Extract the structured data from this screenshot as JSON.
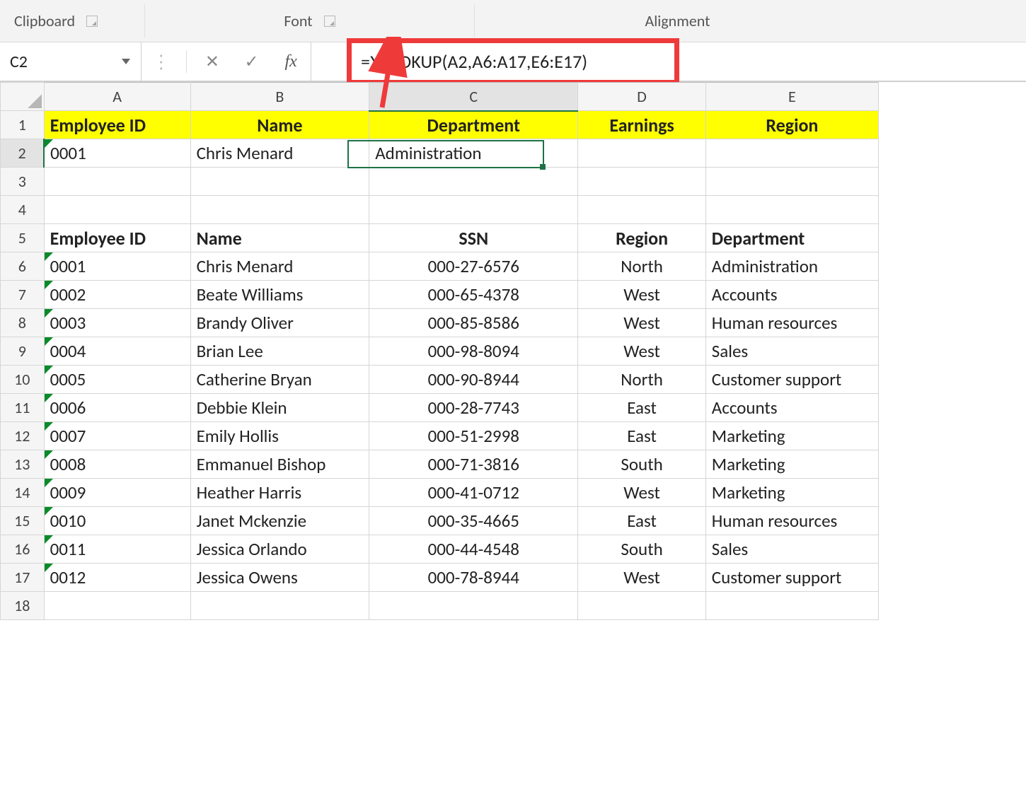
{
  "ribbon": {
    "clipboard": "Clipboard",
    "font": "Font",
    "alignment": "Alignment"
  },
  "formula_bar": {
    "name_box": "C2",
    "formula": "=XLOOKUP(A2,A6:A17,E6:E17)",
    "fx": "fx"
  },
  "columns": [
    "A",
    "B",
    "C",
    "D",
    "E"
  ],
  "rows": [
    "1",
    "2",
    "3",
    "4",
    "5",
    "6",
    "7",
    "8",
    "9",
    "10",
    "11",
    "12",
    "13",
    "14",
    "15",
    "16",
    "17",
    "18"
  ],
  "yellow_headers": {
    "A": "Employee ID",
    "B": "Name",
    "C": "Department",
    "D": "Earnings",
    "E": "Region"
  },
  "result_row": {
    "A": "0001",
    "B": "Chris Menard",
    "C": "Administration",
    "D": "",
    "E": ""
  },
  "table_headers": {
    "A": "Employee ID",
    "B": "Name",
    "C": "SSN",
    "D": "Region",
    "E": "Department"
  },
  "table_rows": [
    {
      "A": "0001",
      "B": "Chris Menard",
      "C": "000-27-6576",
      "D": "North",
      "E": "Administration"
    },
    {
      "A": "0002",
      "B": "Beate Williams",
      "C": "000-65-4378",
      "D": "West",
      "E": "Accounts"
    },
    {
      "A": "0003",
      "B": "Brandy Oliver",
      "C": "000-85-8586",
      "D": "West",
      "E": "Human resources"
    },
    {
      "A": "0004",
      "B": "Brian Lee",
      "C": "000-98-8094",
      "D": "West",
      "E": "Sales"
    },
    {
      "A": "0005",
      "B": "Catherine Bryan",
      "C": "000-90-8944",
      "D": "North",
      "E": "Customer support"
    },
    {
      "A": "0006",
      "B": "Debbie Klein",
      "C": "000-28-7743",
      "D": "East",
      "E": "Accounts"
    },
    {
      "A": "0007",
      "B": "Emily Hollis",
      "C": "000-51-2998",
      "D": "East",
      "E": "Marketing"
    },
    {
      "A": "0008",
      "B": "Emmanuel Bishop",
      "C": "000-71-3816",
      "D": "South",
      "E": "Marketing"
    },
    {
      "A": "0009",
      "B": "Heather Harris",
      "C": "000-41-0712",
      "D": "West",
      "E": "Marketing"
    },
    {
      "A": "0010",
      "B": "Janet Mckenzie",
      "C": "000-35-4665",
      "D": "East",
      "E": "Human resources"
    },
    {
      "A": "0011",
      "B": "Jessica Orlando",
      "C": "000-44-4548",
      "D": "South",
      "E": "Sales"
    },
    {
      "A": "0012",
      "B": "Jessica Owens",
      "C": "000-78-8944",
      "D": "West",
      "E": "Customer support"
    }
  ],
  "active_cell": "C2"
}
